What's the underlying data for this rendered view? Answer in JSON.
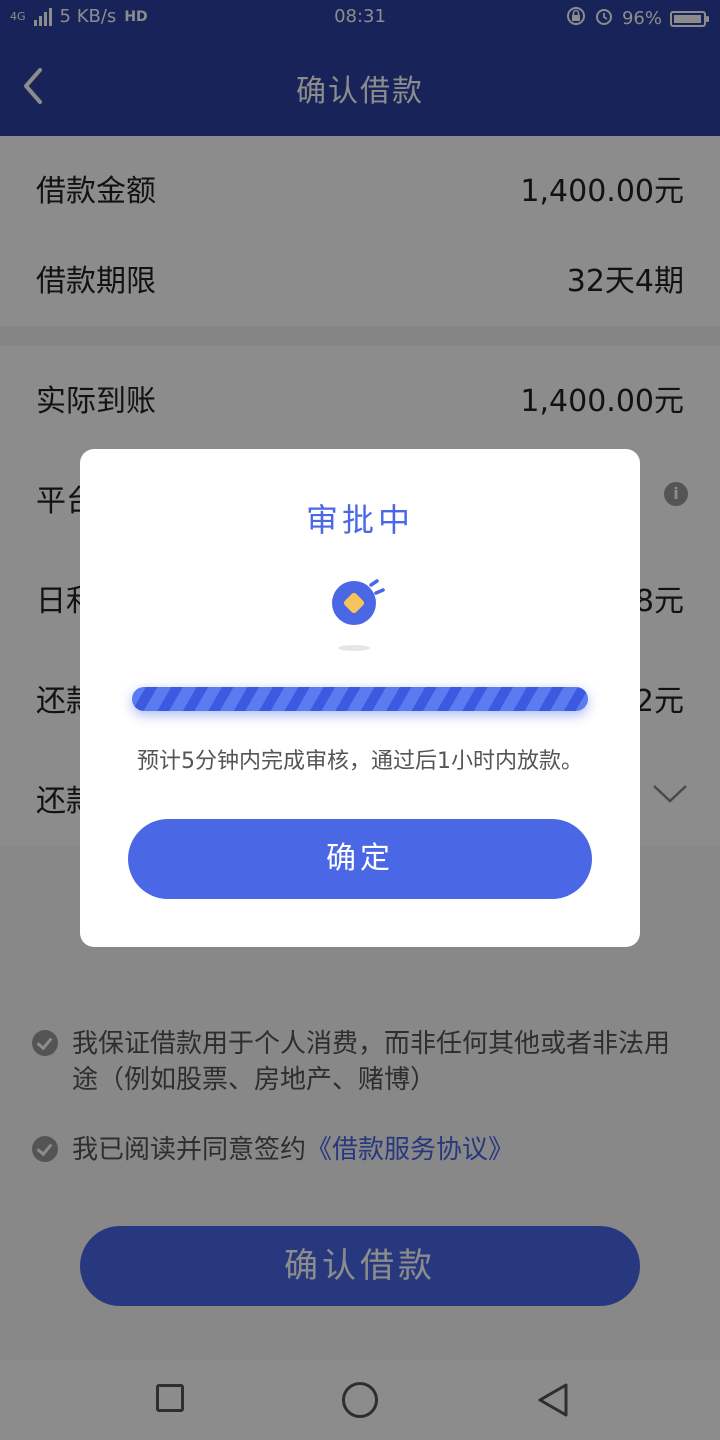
{
  "status_bar": {
    "network": "4G",
    "speed": "5 KB/s",
    "hd": "HD",
    "time": "08:31",
    "battery_text": "96%",
    "battery_level": 0.96
  },
  "header": {
    "title": "确认借款",
    "back_icon": "chevron-left-icon"
  },
  "rows": [
    {
      "label": "借款金额",
      "value": "1,400.00元"
    },
    {
      "label": "借款期限",
      "value": "32天4期"
    },
    {
      "label": "实际到账",
      "value": "1,400.00元"
    },
    {
      "label": "平台",
      "value": ""
    },
    {
      "label": "日利",
      "value": "8元"
    },
    {
      "label": "还款",
      "value": "2元"
    },
    {
      "label": "还款",
      "value": ""
    }
  ],
  "agreements": {
    "purpose": "我保证借款用于个人消费，而非任何其他或者非法用途（例如股票、房地产、赌博）",
    "read_prefix": "我已阅读并同意签约",
    "read_link": "《借款服务协议》"
  },
  "main_button": "确认借款",
  "modal": {
    "title": "审批中",
    "progress": 1.0,
    "description": "预计5分钟内完成审核，通过后1小时内放款。",
    "confirm": "确定"
  },
  "colors": {
    "primary": "#4a67e6",
    "header": "#2b41a3",
    "loader_diamond": "#f5c45a"
  }
}
